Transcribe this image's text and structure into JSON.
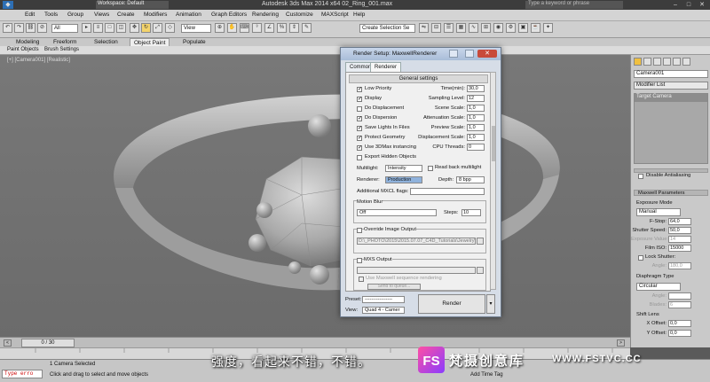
{
  "titlebar": {
    "title": "Autodesk 3ds Max  2014 x64     02_Ring_001.max",
    "workspace": "Workspace: Default",
    "search_placeholder": "Type a keyword or phrase"
  },
  "menu": [
    "Edit",
    "Tools",
    "Group",
    "Views",
    "Create",
    "Modifiers",
    "Animation",
    "Graph Editors",
    "Rendering",
    "Customize",
    "MAXScript",
    "Help"
  ],
  "toolbar": {
    "selection_filter": "All",
    "ref_coord": "View",
    "named_selection": "Create Selection Se"
  },
  "ribbon": {
    "tabs": [
      "Modeling",
      "Freeform",
      "Selection",
      "Object Paint",
      "Populate"
    ],
    "active": "Object Paint",
    "subtabs": [
      "Paint Objects",
      "Brush Settings"
    ]
  },
  "viewport": {
    "label": "[+] [Camera001] [Realistic]"
  },
  "dialog": {
    "title": "Render Setup: MaxwellRenderer",
    "tabs": [
      "Common",
      "Renderer"
    ],
    "active_tab": "Renderer",
    "rollout": "General settings",
    "options": [
      {
        "label": "Low Priority",
        "checked": true
      },
      {
        "label": "Display",
        "checked": true
      },
      {
        "label": "Do Displacement",
        "checked": false
      },
      {
        "label": "Do Dispersion",
        "checked": true
      },
      {
        "label": "Save Lights In Files",
        "checked": true
      },
      {
        "label": "Protect Geometry",
        "checked": true
      },
      {
        "label": "Use 3DMax instancing",
        "checked": true
      },
      {
        "label": "Export Hidden Objects",
        "checked": false
      }
    ],
    "params": [
      {
        "label": "Time(min):",
        "value": "30,0"
      },
      {
        "label": "Sampling Level:",
        "value": "12"
      },
      {
        "label": "Scene Scale:",
        "value": "1,0"
      },
      {
        "label": "Attenuation Scale:",
        "value": "1,0"
      },
      {
        "label": "Preview Scale:",
        "value": "1,0"
      },
      {
        "label": "Displacement Scale:",
        "value": "1,0"
      },
      {
        "label": "CPU Threads:",
        "value": "0"
      }
    ],
    "multilight_label": "Multilight:",
    "multilight_value": "Intensity",
    "read_back_label": "Read back multilight",
    "renderer_label": "Renderer:",
    "renderer_value": "Production",
    "depth_label": "Depth:",
    "depth_value": "8 bpp",
    "mxcl_label": "Additional MXCL flags:",
    "motion_blur_label": "Motion Blur",
    "motion_blur_value": "Off",
    "steps_label": "Steps:",
    "steps_value": "10",
    "override_label": "Override Image Output",
    "override_path": "D:\\_PHOTO\\2015\\2015.07.07_C4D_Tutorials\\Jewelry\\M",
    "mxs_label": "MXS Output",
    "mxs_sequence_label": "Use Maxwell sequence rendering",
    "send_label": "Send to queue...",
    "preset_label": "Preset:",
    "preset_value": "-----------------",
    "view_label": "View:",
    "view_value": "Quad 4 - Camer",
    "render_label": "Render"
  },
  "cmdpanel": {
    "object_name": "Camera001",
    "modifier_list": "Modifier List",
    "stack_item": "Target Camera",
    "disable_antialiasing": "Disable Antialiasing",
    "maxwell_params": "Maxwell Parameters",
    "exposure_mode_label": "Exposure Mode",
    "exposure_mode": "Manual",
    "exposure_fields": [
      {
        "label": "F-Stop:",
        "value": "64,0"
      },
      {
        "label": "Shutter Speed:",
        "value": "50,0"
      },
      {
        "label": "Exposure Value:",
        "value": "14"
      },
      {
        "label": "Film ISO:",
        "value": "15000"
      }
    ],
    "lock_shutter": "Lock Shutter:",
    "angle_label": "Angle:",
    "angle_value": "180,0",
    "diaphragm_label": "Diaphragm Type",
    "diaphragm_value": "Circular",
    "blades_label": "Blades:",
    "blades_value": "6",
    "shift_lens_label": "Shift Lens",
    "x_offset_label": "X Offset:",
    "x_offset_value": "0,0",
    "y_offset_label": "Y Offset:",
    "y_offset_value": "0,0"
  },
  "timeline": {
    "frame": "0 / 30"
  },
  "status": {
    "selected": "1 Camera Selected",
    "prompt": "Click and drag to select and move objects",
    "script": "Type erro",
    "add_time_tag": "Add Time Tag"
  },
  "subtitle": "强度，看起来不错，不错。",
  "watermark": {
    "text": "梵摄创意库",
    "url": "WWW.FSTVC.CC"
  }
}
